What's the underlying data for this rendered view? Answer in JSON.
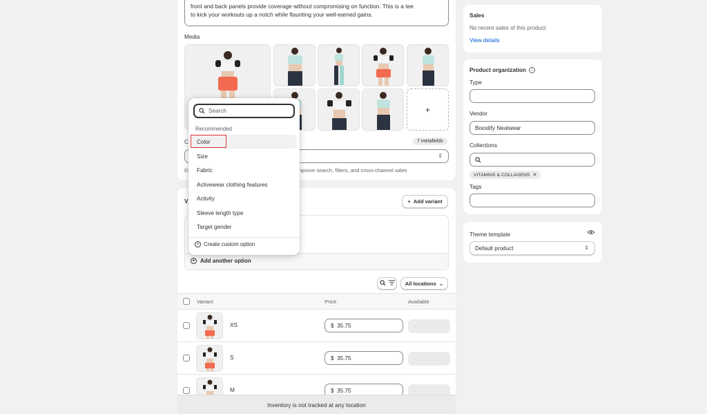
{
  "description": {
    "line1": "front and back panels provide coverage without compromising on function. This is a tee",
    "line2": "to kick your workouts up a notch while flaunting your well-earned gains."
  },
  "media": {
    "label": "Media",
    "add_icon": "+"
  },
  "category": {
    "label_fragment": "C",
    "metafields_badge": "7 metafields",
    "help_fragment_left": "D",
    "help_fragment_right": "nprove search, filters, and cross-channel sales"
  },
  "variants": {
    "heading_fragment": "V",
    "add_variant_label": "Add variant",
    "add_another_option_label": "Add another option",
    "locations_label": "All locations",
    "columns": {
      "variant": "Variant",
      "price": "Price",
      "available": "Available"
    },
    "rows": [
      {
        "name": "XS",
        "currency": "$",
        "price": "35.75",
        "available": "-"
      },
      {
        "name": "S",
        "currency": "$",
        "price": "35.75",
        "available": "-"
      },
      {
        "name": "M",
        "currency": "$",
        "price": "35.75",
        "available": "-"
      }
    ]
  },
  "bottom_bar": {
    "text": "Inventory is not tracked at any location"
  },
  "dropdown": {
    "search_placeholder": "Search",
    "section_label": "Recommended",
    "items": [
      "Color",
      "Size",
      "Fabric",
      "Activewear clothing features",
      "Activity",
      "Sleeve length type",
      "Target gender"
    ],
    "create_label": "Create custom option"
  },
  "sales": {
    "title": "Sales",
    "empty_text": "No recent sales of this product",
    "link": "View details"
  },
  "organization": {
    "title": "Product organization",
    "type_label": "Type",
    "type_value": "",
    "vendor_label": "Vendor",
    "vendor_value": "Boostify Neatwear",
    "collections_label": "Collections",
    "collection_tag": "VITAMINS & COLLAGENS",
    "tags_label": "Tags",
    "tags_value": ""
  },
  "theme": {
    "label": "Theme template",
    "value": "Default product"
  },
  "colors": {
    "accent_link": "#005bd3",
    "highlight": "#e03131",
    "shorts": "#f26a4f",
    "top_teal": "#bfe3df"
  }
}
